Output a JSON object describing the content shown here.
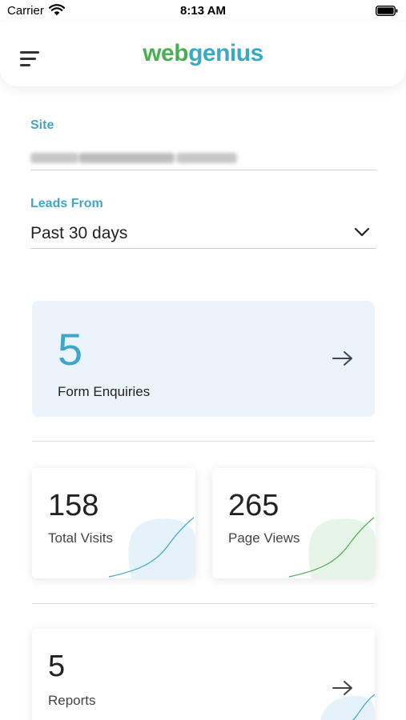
{
  "status_bar": {
    "carrier": "Carrier",
    "time": "8:13 AM"
  },
  "header": {
    "logo_part1": "web",
    "logo_part2": "genius",
    "icons": [
      "menu-icon"
    ]
  },
  "site": {
    "label": "Site",
    "value_obscured": true
  },
  "leads_from": {
    "label": "Leads From",
    "value": "Past 30 days",
    "icon": "chevron-down-icon"
  },
  "form_enquiries": {
    "count": "5",
    "label": "Form Enquiries",
    "icon": "arrow-right-icon"
  },
  "stats": [
    {
      "value": "158",
      "label": "Total Visits",
      "accent": "#3ea7c9",
      "fill": "#e6f2fa"
    },
    {
      "value": "265",
      "label": "Page Views",
      "accent": "#4cae52",
      "fill": "#e6f5e8"
    }
  ],
  "reports": {
    "count": "5",
    "label": "Reports",
    "icon": "arrow-right-icon"
  },
  "colors": {
    "accent_blue": "#3ea7c9",
    "accent_green": "#4cae52",
    "card_tint": "#eaf4fa"
  }
}
